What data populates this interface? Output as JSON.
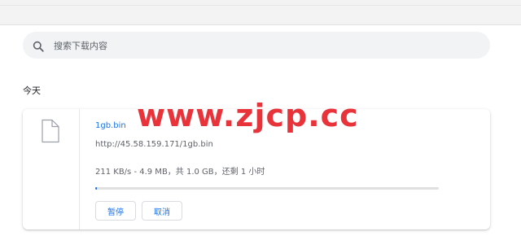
{
  "search": {
    "placeholder": "搜索下载内容"
  },
  "section": {
    "date_heading": "今天"
  },
  "download": {
    "file_name": "1gb.bin",
    "url": "http://45.58.159.171/1gb.bin",
    "status": "211 KB/s - 4.9 MB，共 1.0 GB，还剩 1 小时",
    "progress_fraction": 0.0049,
    "pause_label": "暂停",
    "cancel_label": "取消"
  },
  "watermark": {
    "text": "www.zjcp.cc"
  },
  "icons": {
    "search": "search-icon",
    "file": "file-icon"
  },
  "colors": {
    "accent": "#1a73e8",
    "watermark": "#e8333a",
    "search_bg": "#f1f3f4"
  }
}
